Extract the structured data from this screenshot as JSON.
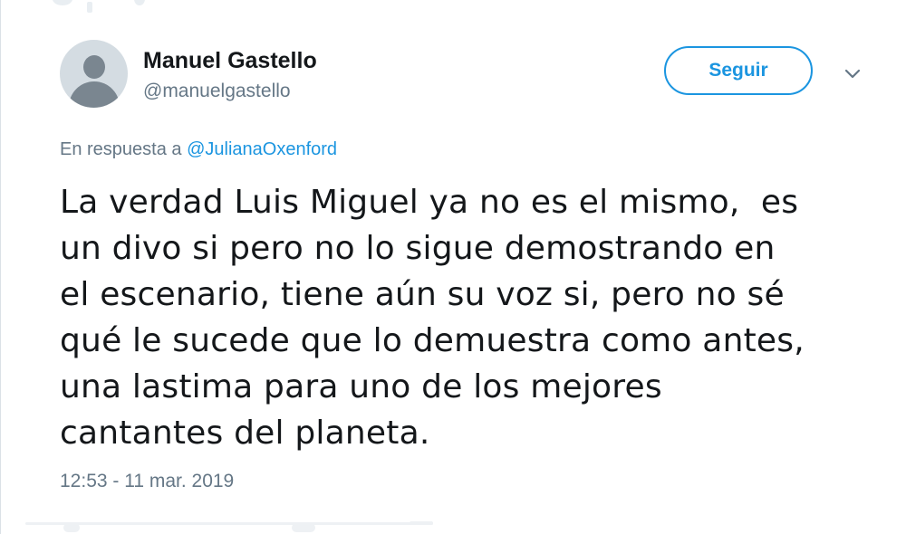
{
  "author": {
    "display_name": "Manuel Gastello",
    "handle": "@manuelgastello",
    "avatar_icon": "default-profile-avatar-icon"
  },
  "actions": {
    "follow_label": "Seguir",
    "more_icon": "chevron-down-icon"
  },
  "reply_context": {
    "prefix": "En respuesta a ",
    "mention": "@JulianaOxenford"
  },
  "tweet": {
    "lines": [
      "La verdad Luis Miguel ya no es el mismo,  es",
      "un divo si pero no lo sigue demostrando en",
      "el escenario, tiene aún su voz si, pero no sé",
      "qué le sucede que lo demuestra como antes,",
      "una lastima para uno de los mejores",
      "cantantes del planeta."
    ],
    "timestamp": "12:53 - 11 mar. 2019"
  },
  "colors": {
    "accent": "#1b95e0",
    "secondary_text": "#657786",
    "primary_text": "#14171a",
    "avatar_bg": "#d4dce2",
    "avatar_fg": "#7a8690"
  }
}
